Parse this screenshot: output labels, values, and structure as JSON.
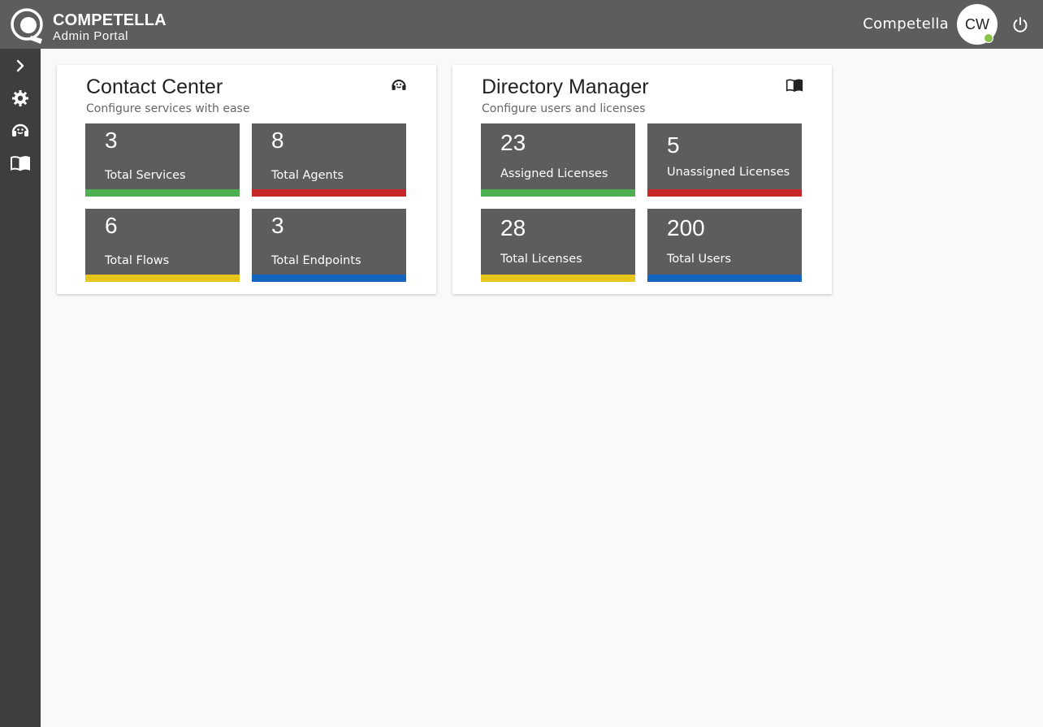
{
  "header": {
    "brand_name": "COMPETELLA",
    "brand_sub": "Admin Portal",
    "user_name": "Competella",
    "avatar_initials": "CW"
  },
  "sidebar": {
    "items": [
      {
        "icon": "chevron-right-icon"
      },
      {
        "icon": "gear-icon"
      },
      {
        "icon": "headset-icon"
      },
      {
        "icon": "book-icon"
      }
    ]
  },
  "colors": {
    "green": "#4caf50",
    "red": "#c62828",
    "yellow": "#e6c619",
    "blue": "#1565c0"
  },
  "cards": [
    {
      "title": "Contact Center",
      "subtitle": "Configure services with ease",
      "icon": "headset-icon",
      "tiles": [
        {
          "value": "3",
          "label": "Total Services",
          "color": "green"
        },
        {
          "value": "8",
          "label": "Total Agents",
          "color": "red"
        },
        {
          "value": "6",
          "label": "Total Flows",
          "color": "yellow"
        },
        {
          "value": "3",
          "label": "Total Endpoints",
          "color": "blue"
        }
      ]
    },
    {
      "title": "Directory Manager",
      "subtitle": "Configure users and licenses",
      "icon": "book-icon",
      "tiles": [
        {
          "value": "23",
          "label": "Assigned Licenses",
          "color": "green"
        },
        {
          "value": "5",
          "label": "Unassigned Licenses",
          "color": "red"
        },
        {
          "value": "28",
          "label": "Total Licenses",
          "color": "yellow"
        },
        {
          "value": "200",
          "label": "Total Users",
          "color": "blue"
        }
      ]
    }
  ]
}
